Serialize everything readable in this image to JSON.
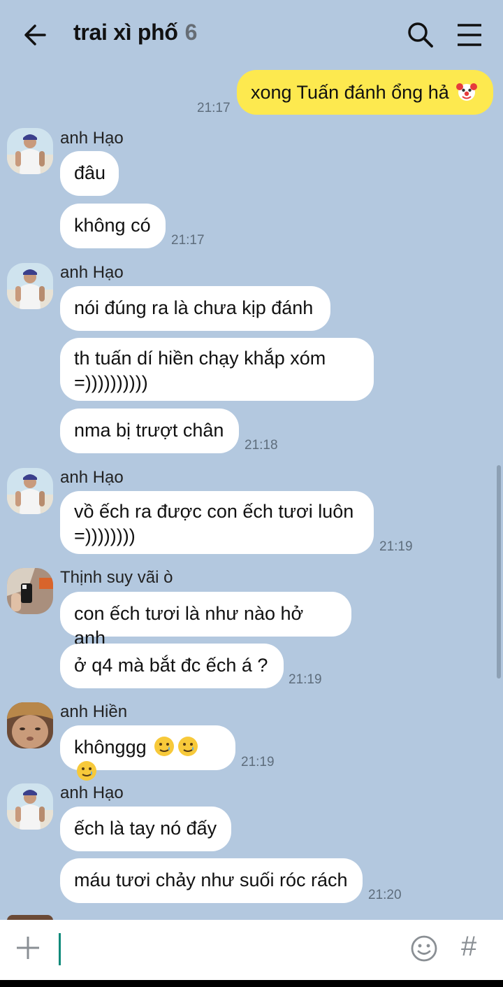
{
  "header": {
    "title": "trai xì phố",
    "member_count": "6"
  },
  "messages": [
    {
      "id": "m1",
      "text": "xong Tuấn đánh ổng hả",
      "emoji": "clown-face",
      "time": "21:17"
    },
    {
      "sender": "anh Hạo",
      "texts": [
        "đâu",
        "không có"
      ],
      "time": "21:17"
    },
    {
      "sender": "anh Hạo",
      "texts": [
        "nói đúng ra là chưa kịp đánh",
        "th tuấn dí hiền chạy khắp xóm",
        "=))))))))))",
        "nma bị trượt chân"
      ],
      "time": "21:18"
    },
    {
      "sender": "anh Hạo",
      "texts": [
        "vồ ếch ra được con ếch tươi luôn",
        "=))))))))"
      ],
      "time": "21:19"
    },
    {
      "sender": "Thịnh suy vãi ò",
      "texts": [
        "con ếch tươi là như nào hở anh",
        "ở q4 mà bắt đc ếch á ?"
      ],
      "time": "21:19"
    },
    {
      "sender": "anh Hiền",
      "texts": [
        "khônggg"
      ],
      "emoji": "smiling-face-with-tear",
      "time": "21:19"
    },
    {
      "sender": "anh Hạo",
      "texts": [
        "ếch là tay nó đấy",
        "máu tươi chảy như suối róc rách"
      ],
      "time": "21:20"
    }
  ],
  "colors": {
    "background": "#b3c8df",
    "my_bubble": "#fde94f",
    "other_bubble": "#ffffff",
    "caret": "#0e8a7a"
  },
  "icons": [
    "arrow-left-icon",
    "search-icon",
    "menu-icon",
    "plus-icon",
    "smiley-icon",
    "hash-icon"
  ],
  "input": {
    "hash_label": "#"
  }
}
